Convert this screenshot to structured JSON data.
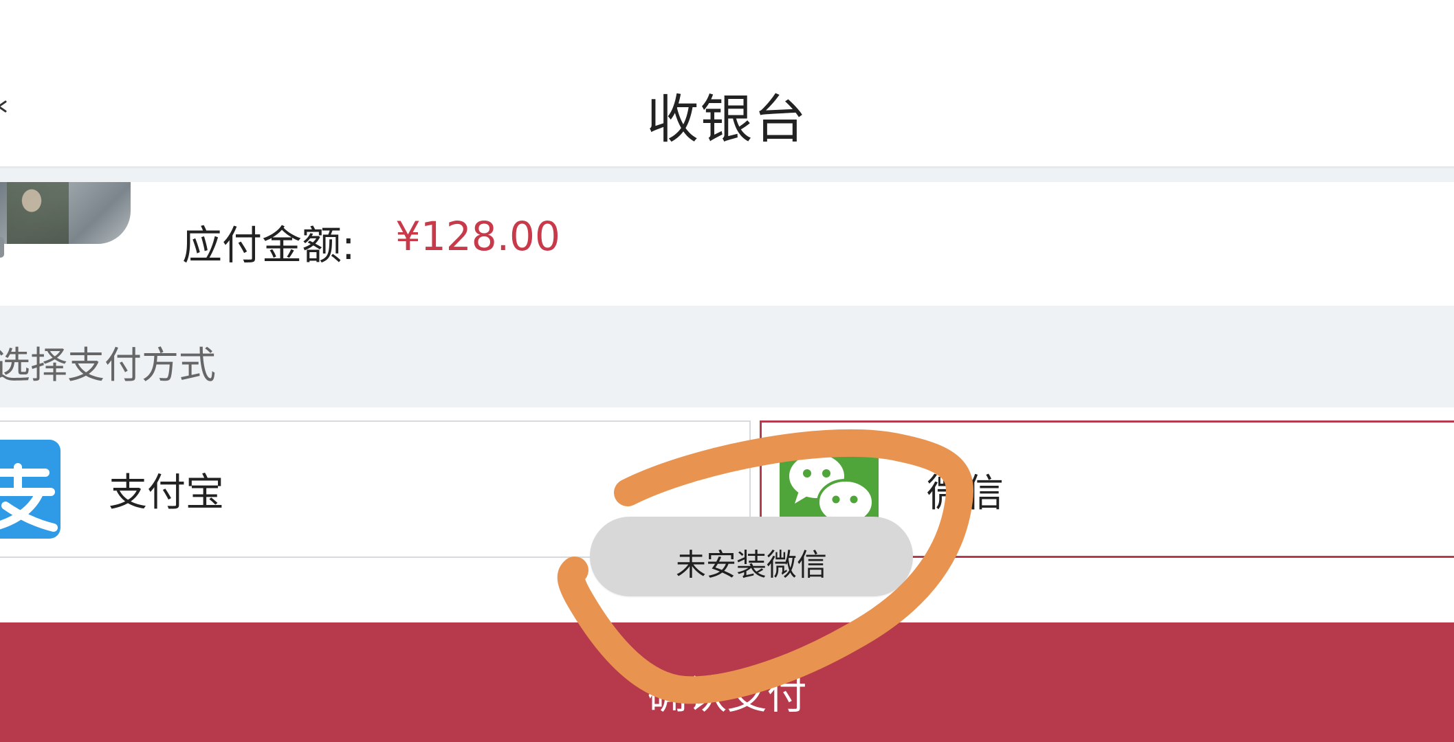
{
  "header": {
    "title": "收银台"
  },
  "amount": {
    "label": "应付金额:",
    "value": "¥128.00"
  },
  "payment_section": {
    "title": "选择支付方式",
    "options": [
      {
        "label": "支付宝",
        "icon": "alipay-logo-icon",
        "selected": false
      },
      {
        "label": "微信",
        "icon": "wechat-logo-icon",
        "selected": true
      }
    ]
  },
  "toast": {
    "text": "未安装微信"
  },
  "pay_button": {
    "label": "确认支付"
  },
  "colors": {
    "accent": "#b63a4b",
    "price": "#c8394a",
    "section_bg": "#eef2f5",
    "alipay": "#2f9be7",
    "wechat": "#4fa53a",
    "annotation": "#e89450"
  }
}
